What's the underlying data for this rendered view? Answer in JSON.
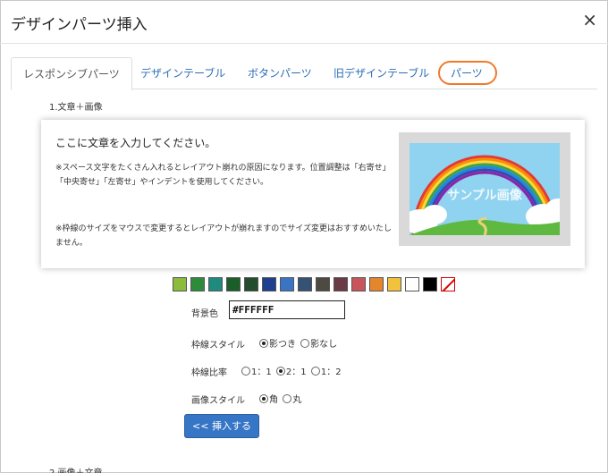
{
  "dialog": {
    "title": "デザインパーツ挿入",
    "close_icon": "close-icon"
  },
  "tabs": [
    {
      "label": "レスポンシブパーツ",
      "active": true
    },
    {
      "label": "デザインテーブル",
      "active": false
    },
    {
      "label": "ボタンパーツ",
      "active": false
    },
    {
      "label": "旧デザインテーブル",
      "active": false
    },
    {
      "label": "パーツ",
      "active": false,
      "highlighted": true
    }
  ],
  "highlight_color": "#f07a2a",
  "section": {
    "label": "1.文章＋画像"
  },
  "preview": {
    "heading": "ここに文章を入力してください。",
    "paragraph1": "※スペース文字をたくさん入れるとレイアウト崩れの原因になります。位置調整は「右寄せ」「中央寄せ」「左寄せ」やインデントを使用してください。",
    "paragraph2": "※枠線のサイズをマウスで変更するとレイアウトが崩れますのでサイズ変更はおすすめいたしません。",
    "image_text": "サンプル画像"
  },
  "swatches": [
    "#8dbb3c",
    "#2e8b3a",
    "#1f8a7e",
    "#1c5e2a",
    "#234d2c",
    "#1e3f8f",
    "#3b74c4",
    "#355173",
    "#4d4a42",
    "#6b3a45",
    "#c9545c",
    "#e6862c",
    "#f2c23c",
    "#ffffff",
    "#000000",
    "none"
  ],
  "background": {
    "label": "背景色",
    "value": "#FFFFFF"
  },
  "border_style": {
    "label": "枠線スタイル",
    "options": [
      {
        "label": "影つき",
        "selected": true
      },
      {
        "label": "影なし",
        "selected": false
      }
    ]
  },
  "border_ratio": {
    "label": "枠線比率",
    "options": [
      {
        "label": "1：1",
        "selected": false
      },
      {
        "label": "2：1",
        "selected": true
      },
      {
        "label": "1：2",
        "selected": false
      }
    ]
  },
  "image_style": {
    "label": "画像スタイル",
    "options": [
      {
        "label": "角",
        "selected": true
      },
      {
        "label": "丸",
        "selected": false
      }
    ]
  },
  "insert_button": {
    "label": "<< 挿入する"
  },
  "next_section": {
    "label": "2.画像＋文章"
  }
}
